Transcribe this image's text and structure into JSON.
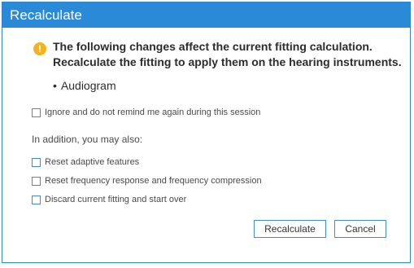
{
  "dialog": {
    "title": "Recalculate",
    "message_line1": "The following changes affect the current fitting calculation.",
    "message_line2": "Recalculate the fitting to apply them on the hearing instruments.",
    "changes": [
      "Audiogram"
    ],
    "ignore_checkbox": {
      "label": "Ignore and do not remind me again during this session",
      "checked": false
    },
    "addition_label": "In addition, you may also:",
    "options": [
      {
        "label": "Reset adaptive features",
        "checked": false
      },
      {
        "label": "Reset frequency response and frequency compression",
        "checked": false
      },
      {
        "label": "Discard current fitting and start over",
        "checked": false
      }
    ],
    "buttons": {
      "recalculate": "Recalculate",
      "cancel": "Cancel"
    },
    "colors": {
      "titlebar": "#2b8ad8",
      "warning": "#f5b21b",
      "accent_border": "#3a8fd8"
    },
    "warning_icon_glyph": "!"
  }
}
